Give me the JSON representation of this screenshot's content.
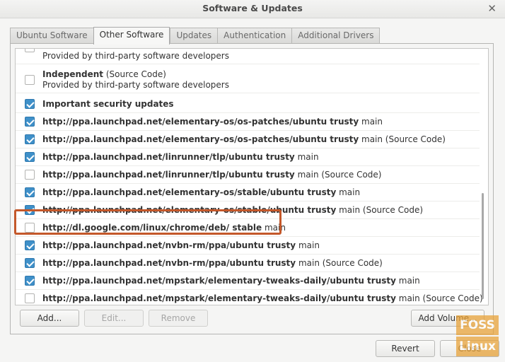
{
  "window": {
    "title": "Software & Updates"
  },
  "tabs": [
    {
      "label": "Ubuntu Software",
      "active": false
    },
    {
      "label": "Other Software",
      "active": true
    },
    {
      "label": "Updates",
      "active": false
    },
    {
      "label": "Authentication",
      "active": false
    },
    {
      "label": "Additional Drivers",
      "active": false
    }
  ],
  "sources": [
    {
      "checked": false,
      "name": "",
      "suffix": "",
      "subtext": "Provided by third-party software developers"
    },
    {
      "checked": false,
      "name": "Independent",
      "suffix": " (Source Code)",
      "subtext": "Provided by third-party software developers"
    },
    {
      "checked": true,
      "name": "Important security updates",
      "suffix": ""
    },
    {
      "checked": true,
      "name": "http://ppa.launchpad.net/elementary-os/os-patches/ubuntu trusty",
      "suffix": " main"
    },
    {
      "checked": true,
      "name": "http://ppa.launchpad.net/elementary-os/os-patches/ubuntu trusty",
      "suffix": " main (Source Code)"
    },
    {
      "checked": true,
      "name": "http://ppa.launchpad.net/linrunner/tlp/ubuntu trusty",
      "suffix": " main"
    },
    {
      "checked": false,
      "name": "http://ppa.launchpad.net/linrunner/tlp/ubuntu trusty",
      "suffix": " main (Source Code)"
    },
    {
      "checked": true,
      "name": "http://ppa.launchpad.net/elementary-os/stable/ubuntu trusty",
      "suffix": " main"
    },
    {
      "checked": true,
      "name": "http://ppa.launchpad.net/elementary-os/stable/ubuntu trusty",
      "suffix": " main (Source Code)"
    },
    {
      "checked": false,
      "name": "http://dl.google.com/linux/chrome/deb/ stable",
      "suffix": " main"
    },
    {
      "checked": true,
      "name": "http://ppa.launchpad.net/nvbn-rm/ppa/ubuntu trusty",
      "suffix": " main"
    },
    {
      "checked": true,
      "name": "http://ppa.launchpad.net/nvbn-rm/ppa/ubuntu trusty",
      "suffix": " main (Source Code)"
    },
    {
      "checked": true,
      "name": "http://ppa.launchpad.net/mpstark/elementary-tweaks-daily/ubuntu trusty",
      "suffix": " main"
    },
    {
      "checked": false,
      "name": "http://ppa.launchpad.net/mpstark/elementary-tweaks-daily/ubuntu trusty",
      "suffix": " main (Source Code)"
    }
  ],
  "buttons": {
    "add": "Add...",
    "edit": "Edit...",
    "remove": "Remove",
    "add_volume": "Add Volume...",
    "revert": "Revert",
    "close": "Close"
  },
  "watermark": {
    "line1": "FOSS",
    "line2": "Linux"
  },
  "colors": {
    "checkbox": "#3f90c9",
    "highlight_box": "#c4582a",
    "watermark": "#e8a33a"
  }
}
